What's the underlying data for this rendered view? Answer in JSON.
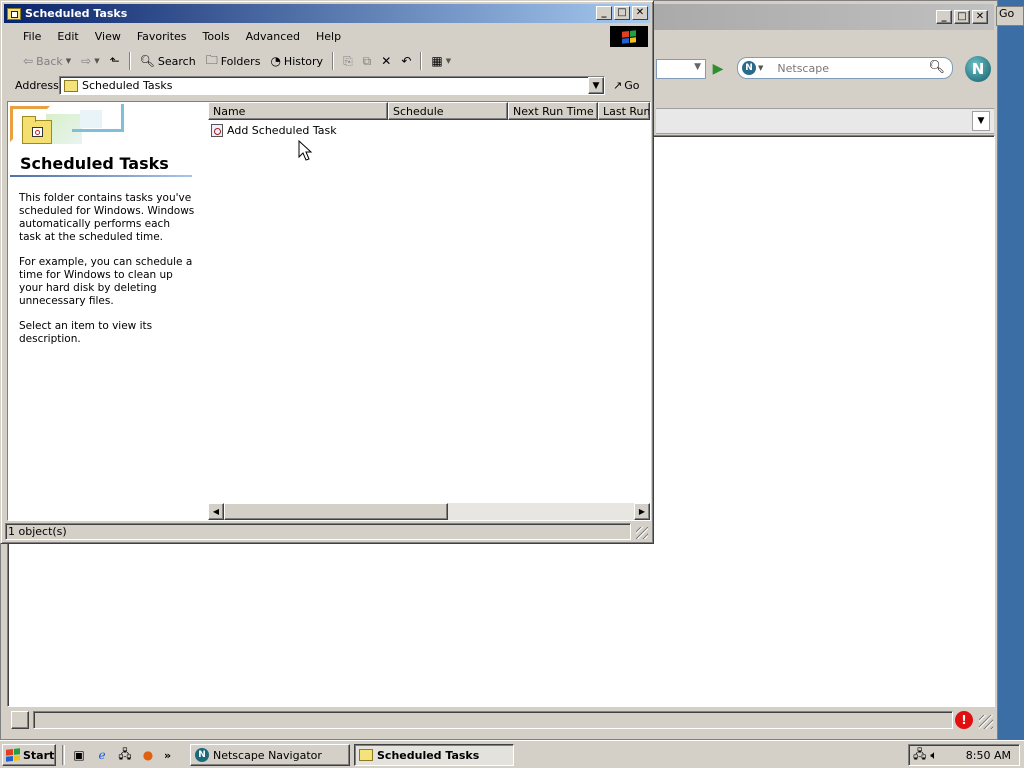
{
  "background_window": {
    "search_placeholder": "Netscape",
    "go_fragment": "Go",
    "logo_letter": "N"
  },
  "explorer": {
    "title": "Scheduled Tasks",
    "menu": [
      "File",
      "Edit",
      "View",
      "Favorites",
      "Tools",
      "Advanced",
      "Help"
    ],
    "toolbar": {
      "back": "Back",
      "search": "Search",
      "folders": "Folders",
      "history": "History"
    },
    "address": {
      "label": "Address",
      "value": "Scheduled Tasks",
      "go": "Go"
    },
    "webview": {
      "title": "Scheduled Tasks",
      "p1": "This folder contains tasks you've scheduled for Windows. Windows automatically performs each task at the scheduled time.",
      "p2": "For example, you can schedule a time for Windows to clean up your hard disk by deleting unnecessary files.",
      "p3": "Select an item to view its description."
    },
    "columns": [
      "Name",
      "Schedule",
      "Next Run Time",
      "Last Run"
    ],
    "items": [
      {
        "name": "Add Scheduled Task"
      }
    ],
    "status": "1 object(s)"
  },
  "taskbar": {
    "start": "Start",
    "more": "»",
    "tasks": [
      {
        "label": "Netscape Navigator",
        "active": false
      },
      {
        "label": "Scheduled Tasks",
        "active": true
      }
    ],
    "clock": "8:50 AM"
  },
  "colors": {
    "titlebar_active_start": "#0a246a",
    "titlebar_active_end": "#a6caf0",
    "face": "#d4d0c8",
    "desktop": "#3a6ea5",
    "warning_red": "#e01010"
  }
}
